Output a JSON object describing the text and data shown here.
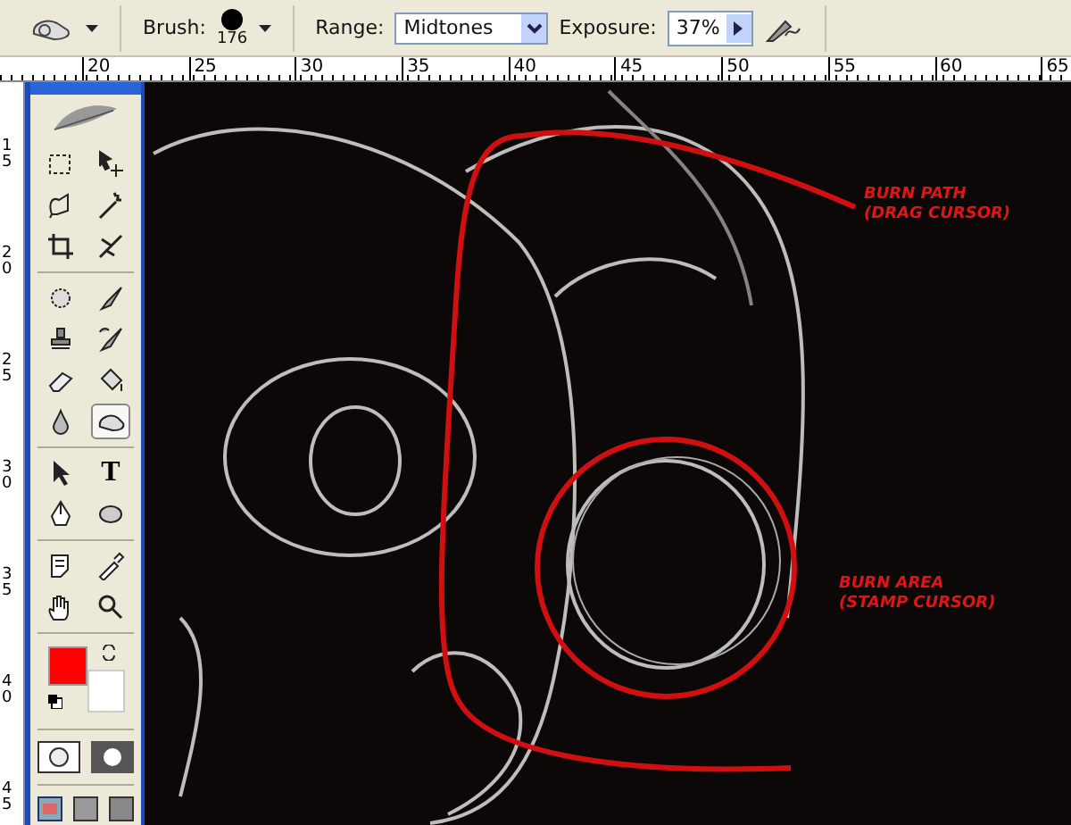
{
  "options_bar": {
    "brush_label": "Brush:",
    "brush_size": "176",
    "range_label": "Range:",
    "range_value": "Midtones",
    "exposure_label": "Exposure:",
    "exposure_value": "37%"
  },
  "top_ruler": [
    "20",
    "25",
    "30",
    "35",
    "40",
    "45",
    "50",
    "55",
    "60",
    "65"
  ],
  "left_ruler": [
    "15",
    "20",
    "25",
    "30",
    "35",
    "40",
    "45"
  ],
  "toolbox": {
    "groups": [
      [
        {
          "kind": "marquee",
          "selected": false
        },
        {
          "kind": "move",
          "selected": false
        },
        {
          "kind": "lasso",
          "selected": false
        },
        {
          "kind": "wand",
          "selected": false
        },
        {
          "kind": "crop",
          "selected": false
        },
        {
          "kind": "slice",
          "selected": false
        }
      ],
      [
        {
          "kind": "heal",
          "selected": false
        },
        {
          "kind": "brush",
          "selected": false
        },
        {
          "kind": "stamp",
          "selected": false
        },
        {
          "kind": "history",
          "selected": false
        },
        {
          "kind": "eraser",
          "selected": false
        },
        {
          "kind": "bucket",
          "selected": false
        },
        {
          "kind": "blur",
          "selected": false
        },
        {
          "kind": "burn",
          "selected": true
        }
      ],
      [
        {
          "kind": "select",
          "selected": false
        },
        {
          "kind": "type",
          "glyph": "T",
          "selected": false
        },
        {
          "kind": "pen",
          "selected": false
        },
        {
          "kind": "shape",
          "selected": false
        }
      ],
      [
        {
          "kind": "notes",
          "selected": false
        },
        {
          "kind": "eyedropper",
          "selected": false
        },
        {
          "kind": "hand",
          "selected": false
        },
        {
          "kind": "zoom",
          "selected": false
        }
      ]
    ],
    "swatches": [
      {
        "kind": "foreground",
        "color": "#ff0000"
      },
      {
        "kind": "background",
        "color": "#ffffff"
      }
    ]
  },
  "annotations": [
    {
      "lines": [
        "BURN PATH",
        "(DRAG CURSOR)"
      ]
    },
    {
      "lines": [
        "BURN AREA",
        "(STAMP CURSOR)"
      ]
    }
  ]
}
